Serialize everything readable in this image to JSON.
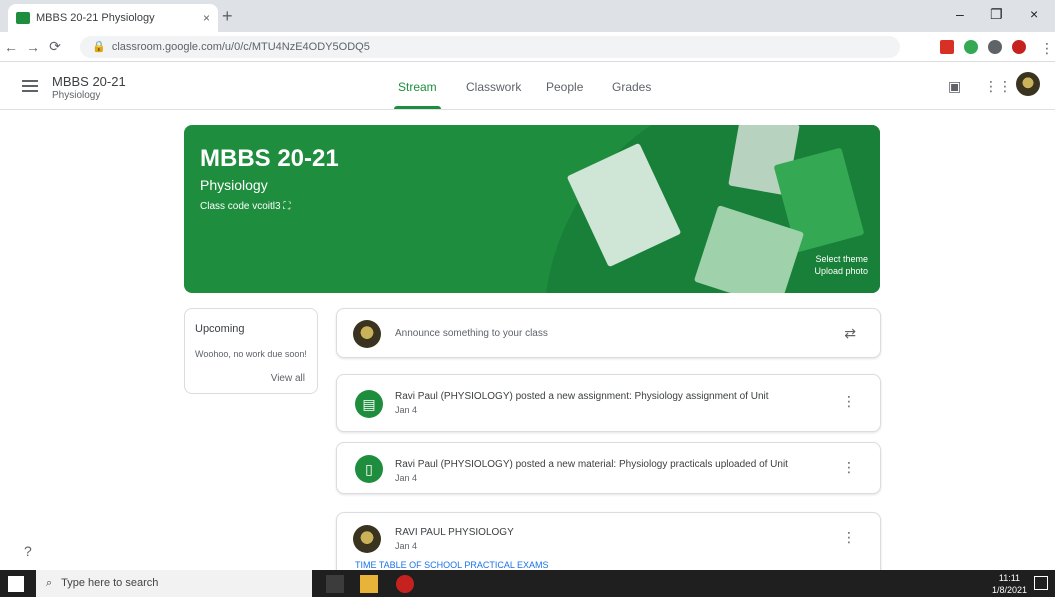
{
  "browser": {
    "tab_title": "MBBS 20-21 Physiology",
    "close_tab": "×",
    "new_tab": "+",
    "url": "classroom.google.com/u/0/c/MTU4NzE4ODY5ODQ5",
    "window_controls": {
      "minimize": "–",
      "maximize": "❐",
      "close": "×"
    }
  },
  "app": {
    "class_name": "MBBS 20-21",
    "class_sub": "Physiology",
    "tabs": [
      "Stream",
      "Classwork",
      "People",
      "Grades"
    ],
    "active_tab": "Stream"
  },
  "banner": {
    "title": "MBBS 20-21",
    "subject": "Physiology",
    "class_code_label": "Class code",
    "class_code": "vcoitl3",
    "select_theme": "Select theme",
    "upload_photo": "Upload photo"
  },
  "upcoming": {
    "heading": "Upcoming",
    "text": "Woohoo, no work due soon!",
    "view_all": "View all"
  },
  "announce": {
    "placeholder": "Announce something to your class"
  },
  "stream": [
    {
      "title": "Ravi Paul (PHYSIOLOGY) posted a new assignment: Physiology assignment of Unit",
      "date": "Jan 4"
    },
    {
      "title": "Ravi Paul (PHYSIOLOGY) posted a new material: Physiology practicals uploaded of Unit",
      "date": "Jan 4"
    },
    {
      "title": "RAVI PAUL PHYSIOLOGY",
      "date": "Jan 4",
      "body": "TIME TABLE OF SCHOOL PRACTICAL EXAMS"
    }
  ],
  "taskbar": {
    "search_placeholder": "Type here to search",
    "time": "11:11",
    "date": "1/8/2021"
  },
  "colors": {
    "accent": "#1e8e3e",
    "banner_dark": "#188038"
  }
}
